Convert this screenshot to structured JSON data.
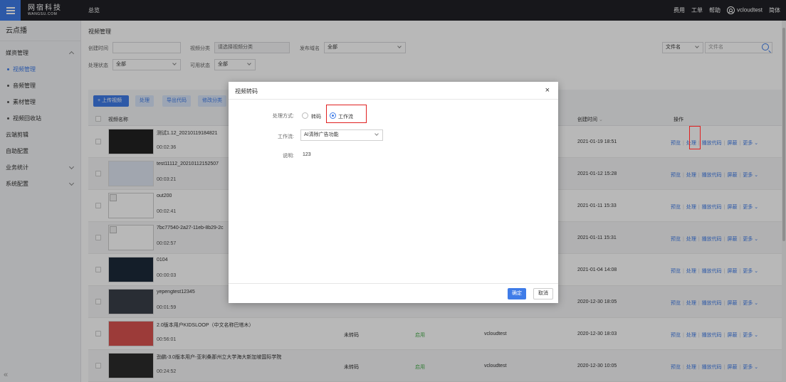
{
  "topbar": {
    "logo_cn": "网宿科技",
    "logo_en": "WANGSU.COM",
    "nav_overview": "总览",
    "links": [
      "费用",
      "工单",
      "帮助"
    ],
    "username": "vcloudtest",
    "language": "简体"
  },
  "sidebar": {
    "title": "云点播",
    "groups": [
      {
        "label": "媒资管理",
        "expanded": true,
        "items": [
          "视频管理",
          "音频管理",
          "素材管理",
          "视频回收站"
        ]
      },
      {
        "label": "云端剪辑"
      },
      {
        "label": "自助配置"
      },
      {
        "label": "业务统计",
        "expanded": false
      },
      {
        "label": "系统配置",
        "expanded": false
      }
    ],
    "collapse": "«"
  },
  "filters": {
    "page_title": "视频管理",
    "created_time_label": "创建时间",
    "category_label": "视频分类",
    "category_placeholder": "请选择视频分类",
    "domain_label": "发布域名",
    "domain_value": "全部",
    "status_label": "处理状态",
    "status_value": "全部",
    "available_label": "可用状态",
    "available_value": "全部",
    "search_type": "文件名",
    "search_placeholder": "文件名"
  },
  "toolbar": {
    "upload": "+ 上传视频",
    "process": "处理",
    "export": "导出代码",
    "edit_category": "修改分类"
  },
  "table": {
    "headers": {
      "name": "视频名称",
      "created": "创建时间",
      "ops": "操作"
    },
    "ops": [
      "预览",
      "处理",
      "播放代码",
      "屏蔽",
      "更多"
    ],
    "rows": [
      {
        "name": "测试1.12_20210119184821",
        "duration": "00:02:36",
        "created": "2021-01-19 18:51"
      },
      {
        "name": "test11112_20210112152507",
        "duration": "00:03:21",
        "created": "2021-01-12 15:28"
      },
      {
        "name": "out200",
        "duration": "00:02:41",
        "created": "2021-01-11 15:33"
      },
      {
        "name": "7bc77540-2a27-11eb-8b29-2c",
        "duration": "00:02:57",
        "created": "2021-01-11 15:31"
      },
      {
        "name": "0104",
        "duration": "00:00:03",
        "created": "2021-01-04 14:08"
      },
      {
        "name": "yepengtest12345",
        "duration": "00:01:59",
        "created": "2020-12-30 18:05"
      },
      {
        "name": "2.0版本用户KIDSLOOP（中文名称巴塔木）",
        "duration": "00:56:01",
        "status": "未转码",
        "available": "启用",
        "owner": "vcloudtest",
        "created": "2020-12-30 18:03"
      },
      {
        "name": "劲鹏-3.0版本用户-亚利桑那州立大学海大新加坡国际学院",
        "duration": "00:24:52",
        "status": "未转码",
        "available": "启用",
        "owner": "vcloudtest",
        "created": "2020-12-30 10:05"
      }
    ]
  },
  "modal": {
    "title": "视频转码",
    "close": "×",
    "method_label": "处理方式:",
    "option_transcode": "转码",
    "option_workflow": "工作流",
    "selected": "workflow",
    "workflow_label": "工作流:",
    "workflow_value": "AI清除广告功能",
    "desc_label": "说明:",
    "desc_value": "123",
    "confirm": "确定",
    "cancel": "取消"
  },
  "colors": {
    "accent": "#3f7ce8",
    "highlight": "#e02020",
    "topbar": "#202126"
  }
}
